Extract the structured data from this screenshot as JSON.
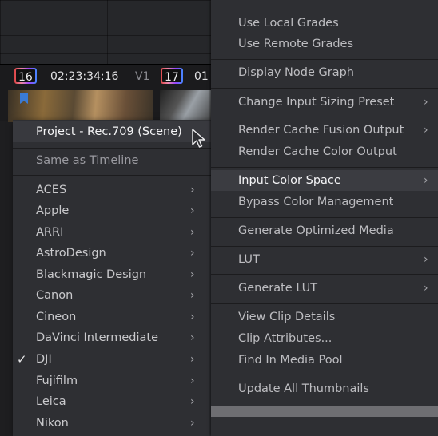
{
  "timeline": {
    "clip1_number": "16",
    "clip1_timecode": "02:23:34:16",
    "clip1_track": "V1",
    "clip2_number": "17",
    "clip2_timecode": "01"
  },
  "color_space_submenu": {
    "items": [
      {
        "label": "Project - Rec.709 (Scene)",
        "highlighted": true
      },
      {
        "label": "Same as Timeline",
        "dim": true
      },
      {
        "label": "ACES",
        "has_submenu": true
      },
      {
        "label": "Apple",
        "has_submenu": true
      },
      {
        "label": "ARRI",
        "has_submenu": true
      },
      {
        "label": "AstroDesign",
        "has_submenu": true
      },
      {
        "label": "Blackmagic Design",
        "has_submenu": true
      },
      {
        "label": "Canon",
        "has_submenu": true
      },
      {
        "label": "Cineon",
        "has_submenu": true
      },
      {
        "label": "DaVinci Intermediate",
        "has_submenu": true
      },
      {
        "label": "DJI",
        "has_submenu": true,
        "checked": true
      },
      {
        "label": "Fujifilm",
        "has_submenu": true
      },
      {
        "label": "Leica",
        "has_submenu": true
      },
      {
        "label": "Nikon",
        "has_submenu": true
      }
    ],
    "check_glyph": "✓",
    "chevron_glyph": "›"
  },
  "context_menu": {
    "items": [
      {
        "label": "Use Local Grades"
      },
      {
        "label": "Use Remote Grades"
      },
      {
        "label": "Display Node Graph"
      },
      {
        "label": "Change Input Sizing Preset",
        "has_submenu": true
      },
      {
        "label": "Render Cache Fusion Output",
        "has_submenu": true
      },
      {
        "label": "Render Cache Color Output"
      },
      {
        "label": "Input Color Space",
        "has_submenu": true,
        "highlighted": true
      },
      {
        "label": "Bypass Color Management"
      },
      {
        "label": "Generate Optimized Media"
      },
      {
        "label": "LUT",
        "has_submenu": true
      },
      {
        "label": "Generate LUT",
        "has_submenu": true
      },
      {
        "label": "View Clip Details"
      },
      {
        "label": "Clip Attributes..."
      },
      {
        "label": "Find In Media Pool"
      },
      {
        "label": "Update All Thumbnails"
      }
    ],
    "chevron_glyph": "›"
  },
  "colors": {
    "menu_bg": "#2e2f33",
    "highlight_bg": "#3b3c41",
    "text": "#bdbdc1",
    "flag_blue": "#3a7bd5"
  }
}
